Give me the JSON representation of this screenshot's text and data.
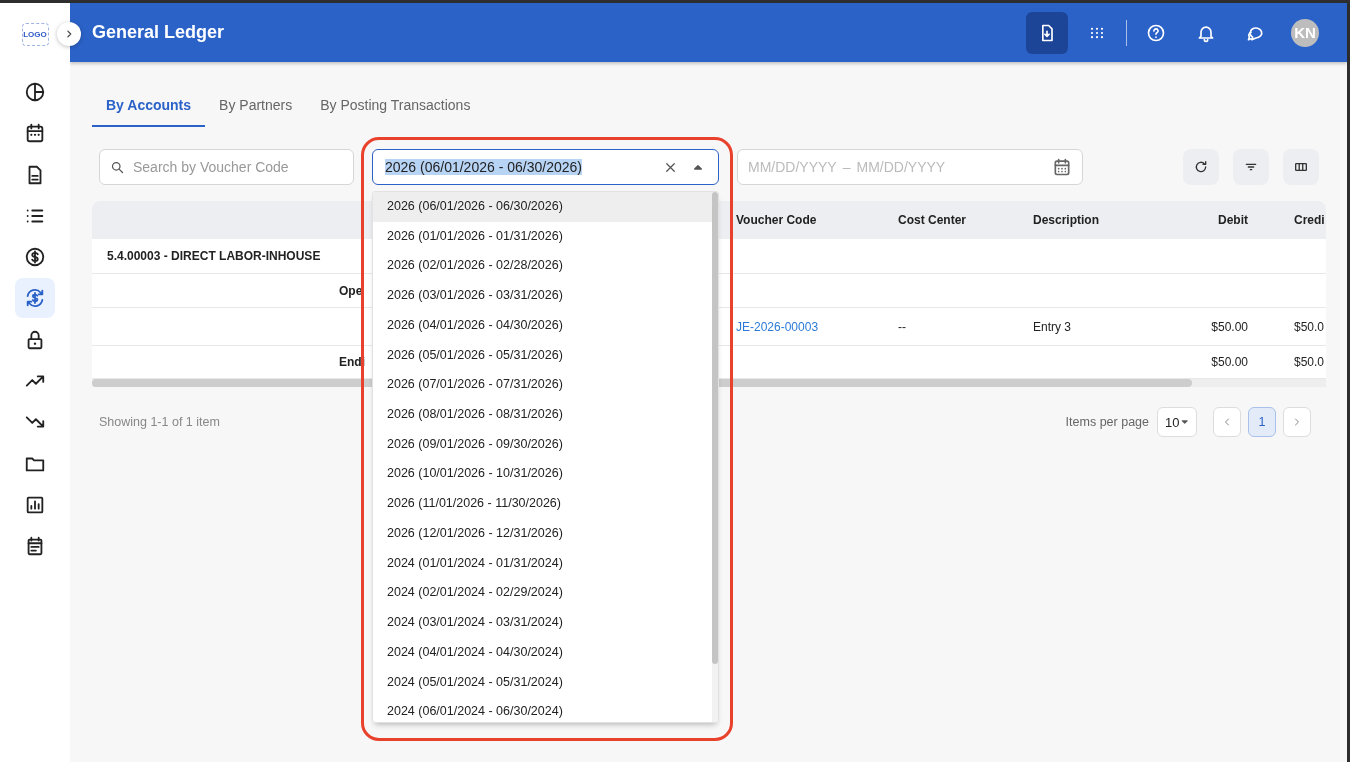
{
  "sidebar": {
    "logo": "LOGO",
    "items": [
      {
        "selected": false
      },
      {
        "selected": false
      },
      {
        "selected": false
      },
      {
        "selected": false
      },
      {
        "selected": false
      },
      {
        "selected": true
      },
      {
        "selected": false
      },
      {
        "selected": false
      },
      {
        "selected": false
      },
      {
        "selected": false
      },
      {
        "selected": false
      },
      {
        "selected": false
      }
    ]
  },
  "header": {
    "title": "General Ledger",
    "avatar": "KN"
  },
  "tabs": [
    {
      "label": "By Accounts",
      "selected": true
    },
    {
      "label": "By Partners",
      "selected": false
    },
    {
      "label": "By Posting Transactions",
      "selected": false
    }
  ],
  "search": {
    "placeholder": "Search by Voucher Code"
  },
  "period_select": {
    "value": "2026 (06/01/2026 - 06/30/2026)",
    "text_selected": true,
    "expanded": true,
    "highlighted": true,
    "options": [
      {
        "label": "2026 (06/01/2026 - 06/30/2026)",
        "selected": true
      },
      {
        "label": "2026 (01/01/2026 - 01/31/2026)",
        "selected": false
      },
      {
        "label": "2026 (02/01/2026 - 02/28/2026)",
        "selected": false
      },
      {
        "label": "2026 (03/01/2026 - 03/31/2026)",
        "selected": false
      },
      {
        "label": "2026 (04/01/2026 - 04/30/2026)",
        "selected": false
      },
      {
        "label": "2026 (05/01/2026 - 05/31/2026)",
        "selected": false
      },
      {
        "label": "2026 (07/01/2026 - 07/31/2026)",
        "selected": false
      },
      {
        "label": "2026 (08/01/2026 - 08/31/2026)",
        "selected": false
      },
      {
        "label": "2026 (09/01/2026 - 09/30/2026)",
        "selected": false
      },
      {
        "label": "2026 (10/01/2026 - 10/31/2026)",
        "selected": false
      },
      {
        "label": "2026 (11/01/2026 - 11/30/2026)",
        "selected": false
      },
      {
        "label": "2026 (12/01/2026 - 12/31/2026)",
        "selected": false
      },
      {
        "label": "2024 (01/01/2024 - 01/31/2024)",
        "selected": false
      },
      {
        "label": "2024 (02/01/2024 - 02/29/2024)",
        "selected": false
      },
      {
        "label": "2024 (03/01/2024 - 03/31/2024)",
        "selected": false
      },
      {
        "label": "2024 (04/01/2024 - 04/30/2024)",
        "selected": false
      },
      {
        "label": "2024 (05/01/2024 - 05/31/2024)",
        "selected": false
      },
      {
        "label": "2024 (06/01/2024 - 06/30/2024)",
        "selected": false
      }
    ]
  },
  "date_range": {
    "start_placeholder": "MM/DD/YYYY",
    "separator": "–",
    "end_placeholder": "MM/DD/YYYY"
  },
  "table": {
    "columns": [
      {
        "label": "Voucher Code"
      },
      {
        "label": "Cost Center"
      },
      {
        "label": "Description"
      },
      {
        "label": "Debit"
      },
      {
        "label": "Credi"
      }
    ],
    "rows": [
      {
        "kind": "account",
        "label": "5.4.00003 - DIRECT LABOR-INHOUSE"
      },
      {
        "kind": "opening",
        "label": "Ope"
      },
      {
        "kind": "entry",
        "voucher_code": "JE-2026-00003",
        "cost_center": "--",
        "description": "Entry 3",
        "debit": "$50.00",
        "credit": "$50.0"
      },
      {
        "kind": "ending",
        "label": "Endi",
        "debit": "$50.00",
        "credit": "$50.0"
      }
    ]
  },
  "pagination": {
    "summary": "Showing 1-1 of 1 item",
    "items_per_page_label": "Items per page",
    "page_size": "10",
    "pages": [
      {
        "label": "1",
        "selected": true
      }
    ]
  }
}
